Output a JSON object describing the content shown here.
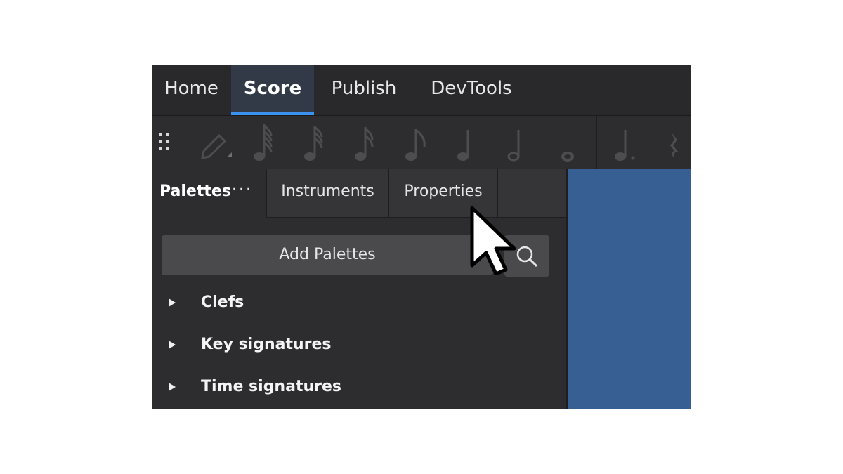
{
  "tabs": [
    {
      "label": "Home",
      "active": false
    },
    {
      "label": "Score",
      "active": true
    },
    {
      "label": "Publish",
      "active": false
    },
    {
      "label": "DevTools",
      "active": false
    }
  ],
  "toolbar": {
    "items": [
      "drag-handle-icon",
      "pencil-icon",
      "64th-note-icon",
      "32nd-note-icon",
      "16th-note-icon",
      "eighth-note-icon",
      "quarter-note-icon",
      "half-note-icon",
      "whole-note-icon",
      "dotted-note-icon",
      "rest-icon"
    ]
  },
  "panel_tabs": {
    "palettes": "Palettes",
    "more": "···",
    "instruments": "Instruments",
    "properties": "Properties"
  },
  "palettes_panel": {
    "add_palettes": "Add Palettes",
    "items": [
      {
        "label": "Clefs"
      },
      {
        "label": "Key signatures"
      },
      {
        "label": "Time signatures"
      }
    ]
  },
  "colors": {
    "accent": "#3c92f0",
    "score_background": "#375f94",
    "panel_background": "#2d2d2f"
  }
}
